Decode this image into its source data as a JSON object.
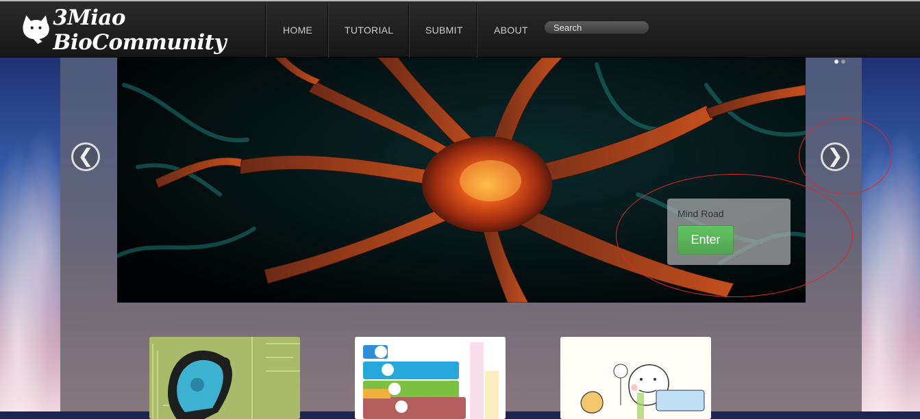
{
  "brand": {
    "name": "3Miao BioCommunity"
  },
  "nav": {
    "items": [
      {
        "label": "HOME"
      },
      {
        "label": "TUTORIAL"
      },
      {
        "label": "SUBMIT"
      },
      {
        "label": "ABOUT"
      }
    ],
    "search_placeholder": "Search"
  },
  "carousel": {
    "slide_caption": "Mind Road",
    "enter_label": "Enter",
    "prev_icon": "chevron-left-icon",
    "next_icon": "chevron-right-icon",
    "prev_glyph": "❮",
    "next_glyph": "❯"
  },
  "thumbnails": [
    {
      "icon": "bacteria-circuit-thumbnail"
    },
    {
      "icon": "circuit-steps-thumbnail"
    },
    {
      "icon": "cartoon-drawing-thumbnail"
    }
  ],
  "colors": {
    "annotation": "#e0262b",
    "enter_button": "#5bb75b"
  }
}
